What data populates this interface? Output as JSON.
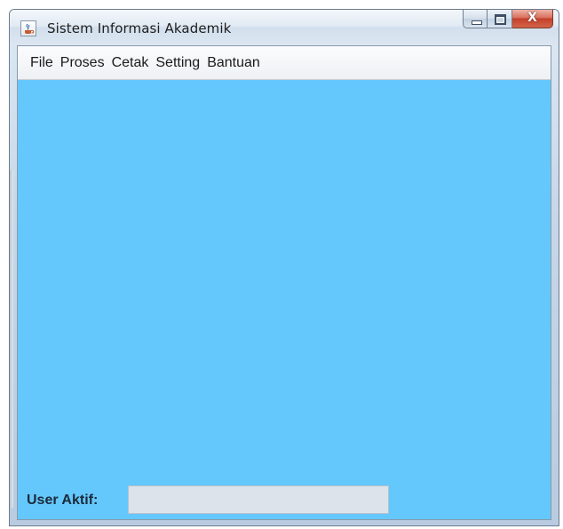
{
  "window": {
    "title": "Sistem Informasi Akademik",
    "icon": "java-cup-icon",
    "controls": {
      "minimize": "minimize-icon",
      "maximize": "maximize-icon",
      "close_label": "X"
    }
  },
  "menubar": {
    "items": [
      {
        "label": "File"
      },
      {
        "label": "Proses"
      },
      {
        "label": "Cetak"
      },
      {
        "label": "Setting"
      },
      {
        "label": "Bantuan"
      }
    ]
  },
  "status": {
    "user_label": "User Aktif:",
    "user_value": ""
  },
  "colors": {
    "content_background": "#65c8fc",
    "field_background": "#dde3ea"
  }
}
